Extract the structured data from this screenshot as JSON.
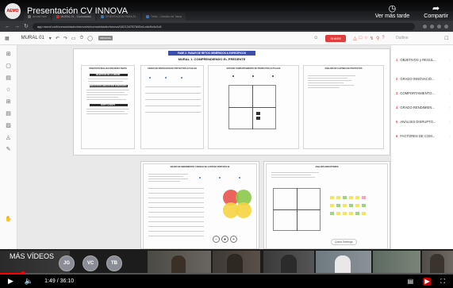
{
  "video": {
    "channel_avatar_text": "AEMO",
    "title": "Presentación CV INNOVA",
    "actions": [
      {
        "label": "Ver más tarde",
        "icon": "clock-icon"
      },
      {
        "label": "Compartir",
        "icon": "share-arrow-icon"
      }
    ],
    "more_videos_label": "MÁS VÍDEOS",
    "time_current": "1:49",
    "time_total": "36:10",
    "time_separator": "/",
    "progress_fraction": 0.05
  },
  "browser": {
    "tabs": [
      {
        "label": "Arnold Hub",
        "color": "#888888",
        "active": false
      },
      {
        "label": "MURAL 01 - Comunidad",
        "color": "#e23d3d",
        "active": true
      },
      {
        "label": "ORIENTACIÓN PARA EL",
        "color": "#4a90d9",
        "active": false
      },
      {
        "label": "Trello – Gestión de Tarea",
        "color": "#4a90d9",
        "active": false
      }
    ],
    "url": "app.mural.co/t/comunidadcvinnova/m/comunidadcvinnova/1621347876/f2a1c4e4b4c2c8"
  },
  "mural": {
    "board_name": "MURAL 01",
    "tag": "ORIGINAL",
    "share_label": "SHARE",
    "outline_title": "Outline",
    "page_banner": "FASE 2. PASAR DE RETOS GENÉRICOS A ESPECÍFICOS",
    "mural_heading": "MURAL 1. COMPRENDIENDO EL PRESENTE",
    "panels": {
      "p1_title": "OBJETIVOS REALIZACIÓN RESULTADOS",
      "p1_sub1": "OBJETIVOS DE LA MISIÓN",
      "p1_sub2": "RESULTADOS INNOVACIÓN ESPERADOS",
      "p1_sub3": "PARTY EVENTS",
      "p2_title": "GRADO DE INNOVACIÓN DE PROYECTOS ACTUALES",
      "p3_title": "ESTUDIO COMPORTAMIENTO DE PRODUCTOS ACTUALES",
      "p4_title": "ANÁLISIS DE CARTERA DE PROYECTOS",
      "p5_title": "GRADO DE RENDIMIENTO Y RIESGO DE CARTERA PORTAFOLIO",
      "p6_title": "ANÁLISIS DISRUPTORES"
    },
    "quick_settings": "Quick Settings",
    "outline_items": [
      {
        "num": "1",
        "label": "OBJETIVOS y RESUL..."
      },
      {
        "num": "2",
        "label": "GRADO INNOVACIÓ..."
      },
      {
        "num": "3",
        "label": "COMPORTAMIENTO..."
      },
      {
        "num": "4",
        "label": "GRADO RENDIMIEN..."
      },
      {
        "num": "5",
        "label": "ANÁLISIS DISRUPTO..."
      },
      {
        "num": "6",
        "label": "FACTORES DE COM..."
      }
    ]
  },
  "participants": [
    {
      "initials": "JG"
    },
    {
      "initials": "VC"
    },
    {
      "initials": "TB"
    }
  ]
}
